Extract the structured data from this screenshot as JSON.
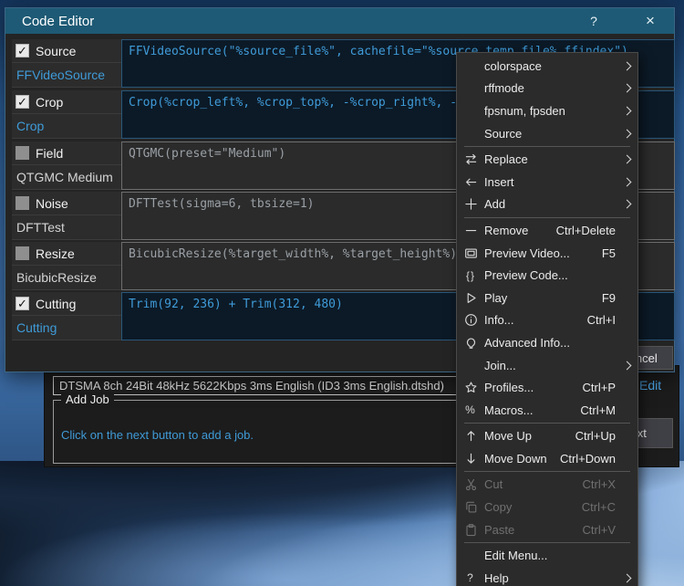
{
  "dialog": {
    "title": "Code Editor",
    "titlebar_help": "?",
    "titlebar_close": "×",
    "cancel_button": "Cancel",
    "filters": [
      {
        "category": "Source",
        "name": "FFVideoSource",
        "checked": true,
        "code": "FFVideoSource(\"%source_file%\", cachefile=\"%source_temp_file%.ffindex\")"
      },
      {
        "category": "Crop",
        "name": "Crop",
        "checked": true,
        "code": "Crop(%crop_left%, %crop_top%, -%crop_right%, -%crop_bottom%)"
      },
      {
        "category": "Field",
        "name": "QTGMC Medium",
        "checked": false,
        "code": "QTGMC(preset=\"Medium\")"
      },
      {
        "category": "Noise",
        "name": "DFTTest",
        "checked": false,
        "code": "DFTTest(sigma=6, tbsize=1)"
      },
      {
        "category": "Resize",
        "name": "BicubicResize",
        "checked": false,
        "code": "BicubicResize(%target_width%, %target_height%)"
      },
      {
        "category": "Cutting",
        "name": "Cutting",
        "checked": true,
        "code": "Trim(92, 236) + Trim(312, 480)"
      }
    ]
  },
  "menu": {
    "items": [
      {
        "label": "colorspace",
        "icon": null,
        "shortcut": "",
        "submenu": true,
        "enabled": true,
        "sep": false
      },
      {
        "label": "rffmode",
        "icon": null,
        "shortcut": "",
        "submenu": true,
        "enabled": true,
        "sep": false
      },
      {
        "label": "fpsnum, fpsden",
        "icon": null,
        "shortcut": "",
        "submenu": true,
        "enabled": true,
        "sep": false
      },
      {
        "label": "Source",
        "icon": null,
        "shortcut": "",
        "submenu": true,
        "enabled": true,
        "sep": true
      },
      {
        "label": "Replace",
        "icon": "swap",
        "shortcut": "",
        "submenu": true,
        "enabled": true,
        "sep": false
      },
      {
        "label": "Insert",
        "icon": "arrow-left",
        "shortcut": "",
        "submenu": true,
        "enabled": true,
        "sep": false
      },
      {
        "label": "Add",
        "icon": "plus",
        "shortcut": "",
        "submenu": true,
        "enabled": true,
        "sep": true
      },
      {
        "label": "Remove",
        "icon": "minus",
        "shortcut": "Ctrl+Delete",
        "submenu": false,
        "enabled": true,
        "sep": false
      },
      {
        "label": "Preview Video...",
        "icon": "monitor",
        "shortcut": "F5",
        "submenu": false,
        "enabled": true,
        "sep": false
      },
      {
        "label": "Preview Code...",
        "icon": "braces",
        "shortcut": "",
        "submenu": false,
        "enabled": true,
        "sep": false
      },
      {
        "label": "Play",
        "icon": "play",
        "shortcut": "F9",
        "submenu": false,
        "enabled": true,
        "sep": false
      },
      {
        "label": "Info...",
        "icon": "info",
        "shortcut": "Ctrl+I",
        "submenu": false,
        "enabled": true,
        "sep": false
      },
      {
        "label": "Advanced Info...",
        "icon": "bulb",
        "shortcut": "",
        "submenu": false,
        "enabled": true,
        "sep": false
      },
      {
        "label": "Join...",
        "icon": null,
        "shortcut": "",
        "submenu": true,
        "enabled": true,
        "sep": false
      },
      {
        "label": "Profiles...",
        "icon": "star",
        "shortcut": "Ctrl+P",
        "submenu": false,
        "enabled": true,
        "sep": false
      },
      {
        "label": "Macros...",
        "icon": "percent",
        "shortcut": "Ctrl+M",
        "submenu": false,
        "enabled": true,
        "sep": true
      },
      {
        "label": "Move Up",
        "icon": "arrow-up",
        "shortcut": "Ctrl+Up",
        "submenu": false,
        "enabled": true,
        "sep": false
      },
      {
        "label": "Move Down",
        "icon": "arrow-down",
        "shortcut": "Ctrl+Down",
        "submenu": false,
        "enabled": true,
        "sep": true
      },
      {
        "label": "Cut",
        "icon": "scissors",
        "shortcut": "Ctrl+X",
        "submenu": false,
        "enabled": false,
        "sep": false
      },
      {
        "label": "Copy",
        "icon": "copy",
        "shortcut": "Ctrl+C",
        "submenu": false,
        "enabled": false,
        "sep": false
      },
      {
        "label": "Paste",
        "icon": "paste",
        "shortcut": "Ctrl+V",
        "submenu": false,
        "enabled": false,
        "sep": true
      },
      {
        "label": "Edit Menu...",
        "icon": null,
        "shortcut": "",
        "submenu": false,
        "enabled": true,
        "sep": false
      },
      {
        "label": "Help",
        "icon": "help",
        "shortcut": "",
        "submenu": true,
        "enabled": true,
        "sep": false
      }
    ]
  },
  "main_window": {
    "audio_track": "DTSMA 8ch 24Bit 48kHz 5622Kbps 3ms English (ID3 3ms English.dtshd)",
    "audio_edit": "Edit",
    "add_job_title": "Add Job",
    "add_job_hint": "Click on the next button to add a job.",
    "next_button": "Next"
  },
  "colors": {
    "titlebar": "#1e5a75",
    "accent_blue": "#3f9bd8",
    "menu_bg": "#2b2b2b",
    "dialog_bg": "#242424"
  }
}
